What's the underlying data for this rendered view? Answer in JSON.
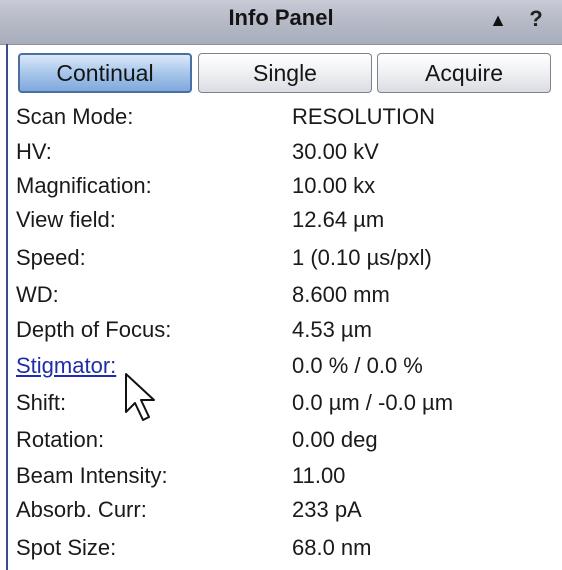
{
  "panel": {
    "title": "Info Panel",
    "collapse_icon": "▲",
    "help_icon": "?"
  },
  "scan_buttons": [
    {
      "label": "Continual",
      "active": true
    },
    {
      "label": "Single",
      "active": false
    },
    {
      "label": "Acquire",
      "active": false
    }
  ],
  "info": [
    {
      "label": "Scan Mode:",
      "value": "RESOLUTION"
    },
    {
      "label": "HV:",
      "value": "30.00 kV"
    },
    {
      "label": "Magnification:",
      "value": "10.00 kx"
    },
    {
      "label": "View field:",
      "value": "12.64 µm"
    },
    {
      "label": "Speed:",
      "value": "1 (0.10 µs/pxl)"
    },
    {
      "label": "WD:",
      "value": "8.600 mm"
    },
    {
      "label": "Depth of Focus:",
      "value": "4.53 µm"
    },
    {
      "label": "Stigmator:",
      "value": "0.0 % / 0.0 %",
      "link": true
    },
    {
      "label": "Shift:",
      "value": "0.0 µm / -0.0 µm"
    },
    {
      "label": "Rotation:",
      "value": "0.00 deg"
    },
    {
      "label": "Beam Intensity:",
      "value": "11.00"
    },
    {
      "label": "Absorb. Curr:",
      "value": "233 pA"
    },
    {
      "label": "Spot Size:",
      "value": "68.0 nm"
    }
  ],
  "colors": {
    "active_button": "#8fb4e2",
    "link": "#1f2ea8",
    "accent_rule": "#3b4a96"
  }
}
